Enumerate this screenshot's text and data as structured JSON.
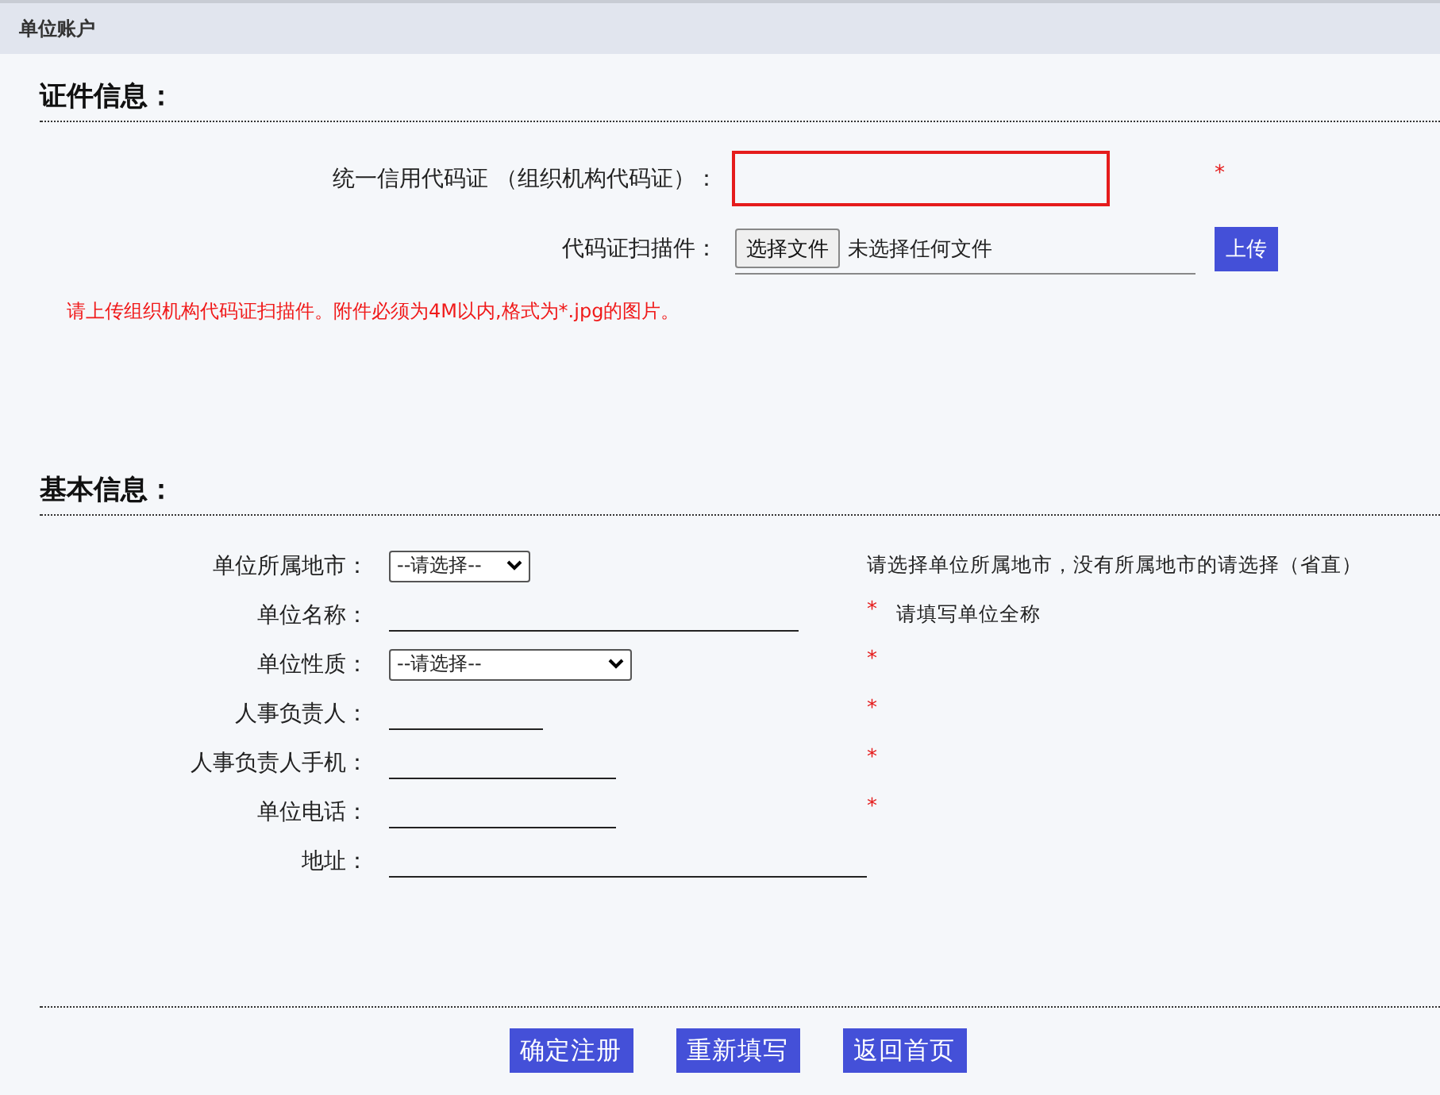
{
  "header": {
    "title": "单位账户"
  },
  "certificate": {
    "title": "证件信息：",
    "code_label": "统一信用代码证 （组织机构代码证）：",
    "code_required": "*",
    "scan_label": "代码证扫描件：",
    "file_button": "选择文件",
    "file_status": "未选择任何文件",
    "upload_button": "上传",
    "note": "请上传组织机构代码证扫描件。附件必须为4M以内,格式为*.jpg的图片。"
  },
  "basic": {
    "title": "基本信息：",
    "rows": [
      {
        "label": "单位所属地市：",
        "kind": "select",
        "value": "--请选择--",
        "note": "请选择单位所属地市，没有所属地市的请选择（省直）"
      },
      {
        "label": "单位名称：",
        "kind": "line",
        "required": "*",
        "note": "请填写单位全称"
      },
      {
        "label": "单位性质：",
        "kind": "select",
        "value": "--请选择--",
        "required": "*"
      },
      {
        "label": "人事负责人：",
        "kind": "line",
        "required": "*"
      },
      {
        "label": "人事负责人手机：",
        "kind": "line",
        "required": "*"
      },
      {
        "label": "单位电话：",
        "kind": "line",
        "required": "*"
      },
      {
        "label": "地址：",
        "kind": "line"
      }
    ]
  },
  "buttons": [
    "确定注册",
    "重新填写",
    "返回首页"
  ]
}
